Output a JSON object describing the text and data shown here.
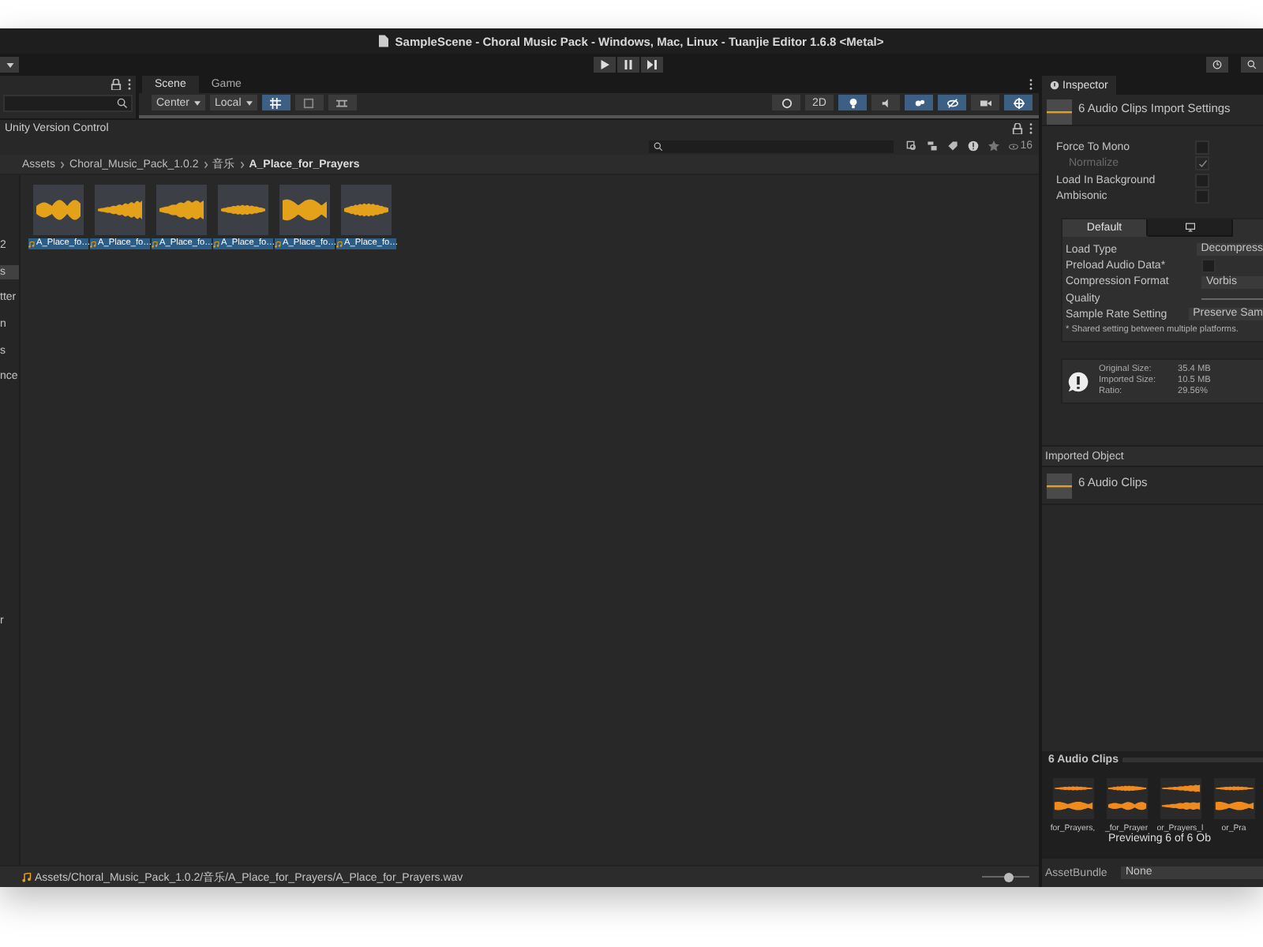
{
  "window": {
    "title": "SampleScene - Choral Music Pack - Windows, Mac, Linux - Tuanjie Editor 1.6.8 <Metal>"
  },
  "scene_tabs": [
    {
      "label": "Scene",
      "selected": true
    },
    {
      "label": "Game",
      "selected": false
    }
  ],
  "scene_toolbar": {
    "pivot": "Center",
    "space": "Local",
    "mode_2d": "2D"
  },
  "project": {
    "toolbar_button": "Unity Version Control",
    "visible_count": "16",
    "breadcrumb": [
      "Assets",
      "Choral_Music_Pack_1.0.2",
      "音乐",
      "A_Place_for_Prayers"
    ],
    "tree_items": [
      {
        "label": "2",
        "selected": false
      },
      {
        "label": "s",
        "selected": true
      },
      {
        "label": "tter",
        "selected": false
      },
      {
        "label": "n",
        "selected": false
      },
      {
        "label": "s",
        "selected": false
      },
      {
        "label": "nce",
        "selected": false
      }
    ],
    "tree_tail": "r",
    "assets": [
      {
        "label": "A_Place_fo…",
        "selected": true
      },
      {
        "label": "A_Place_fo…",
        "selected": true
      },
      {
        "label": "A_Place_fo…",
        "selected": true
      },
      {
        "label": "A_Place_fo…",
        "selected": true
      },
      {
        "label": "A_Place_fo…",
        "selected": true
      },
      {
        "label": "A_Place_fo…",
        "selected": true
      }
    ],
    "status_path": "Assets/Choral_Music_Pack_1.0.2/音乐/A_Place_for_Prayers/A_Place_for_Prayers.wav",
    "zoom": {
      "level": 0.55
    }
  },
  "inspector": {
    "tab": "Inspector",
    "header": "6 Audio Clips Import Settings",
    "options": [
      {
        "label": "Force To Mono",
        "checked": false,
        "disabled": false
      },
      {
        "label": "Normalize",
        "checked": true,
        "disabled": true
      },
      {
        "label": "Load In Background",
        "checked": false,
        "disabled": false
      },
      {
        "label": "Ambisonic",
        "checked": false,
        "disabled": false
      }
    ],
    "platform_tabs": [
      {
        "kind": "text",
        "label": "Default",
        "selected": true
      },
      {
        "kind": "monitor",
        "selected": false
      }
    ],
    "settings": [
      {
        "kind": "dropdown",
        "label": "Load Type",
        "value": "Decompress"
      },
      {
        "kind": "checkbox",
        "label": "Preload Audio Data*",
        "checked": false
      },
      {
        "kind": "dropdown",
        "label": "Compression Format",
        "value": "Vorbis"
      },
      {
        "kind": "slider",
        "label": "Quality"
      },
      {
        "kind": "dropdown",
        "label": "Sample Rate Setting",
        "value": "Preserve Sam"
      }
    ],
    "note": "* Shared setting between multiple platforms.",
    "info": [
      {
        "label": "Original Size:",
        "value": "35.4 MB"
      },
      {
        "label": "Imported Size:",
        "value": "10.5 MB"
      },
      {
        "label": "Ratio:",
        "value": "29.56%"
      }
    ],
    "imported_object": {
      "title": "Imported Object",
      "name": "6 Audio Clips"
    },
    "preview": {
      "title": "6 Audio Clips",
      "clips": [
        "for_Prayers,",
        "_for_Prayer",
        "or_Prayers_l",
        "or_Pra"
      ],
      "caption": "Previewing 6 of 6 Ob"
    },
    "asset_bundle": {
      "label": "AssetBundle",
      "value": "None"
    }
  }
}
